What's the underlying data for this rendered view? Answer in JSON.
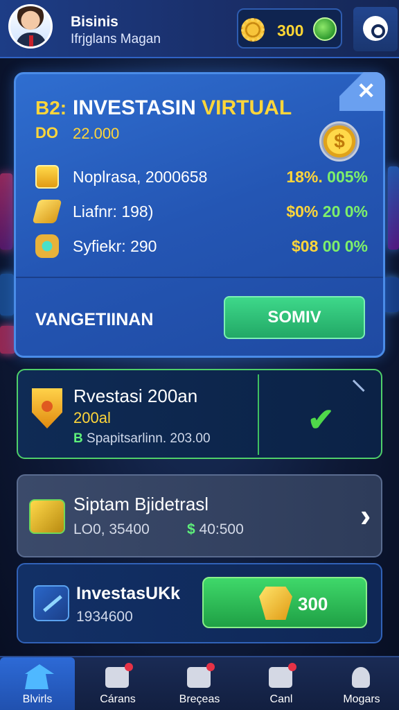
{
  "header": {
    "business_name": "Bisinis",
    "business_subtitle": "Ifrjglans Magan",
    "wallet_amount": "300"
  },
  "panel": {
    "badge": "B2:",
    "title_main": "INVESTASIN",
    "title_highlight": "VIRTUAL",
    "code": "DO",
    "value": "22.000",
    "close_label": "✕",
    "stats": [
      {
        "label": "Noplrasa, 2000658",
        "value": "18%.",
        "value_green": "005%"
      },
      {
        "label": "Liafnr: 198)",
        "value": "$0%",
        "value_green": "20 0%"
      },
      {
        "label": "Syfiekr: 290",
        "value": "$08",
        "value_green": "00 0%"
      }
    ],
    "footer_label": "VANGETIINAN",
    "submit_label": "SOMIV",
    "coin_symbol": "$"
  },
  "investment_card": {
    "title": "Rvestasi  200an",
    "subtitle": "200al",
    "note_prefix": "B",
    "note": "Spapitsarlinn. 203.00",
    "check_symbol": "✔"
  },
  "upgrade_card": {
    "title": "Siptam Bjidetrasl",
    "cost": "LO0, 35400",
    "price_prefix": "$",
    "price": "40:500",
    "chevron": "›"
  },
  "new_investment_card": {
    "title": "InvestasUKk",
    "value": "1934600",
    "buy_label": "300"
  },
  "bottom_nav": {
    "items": [
      {
        "label": "Blvirls",
        "icon": "home-icon"
      },
      {
        "label": "Cárans",
        "icon": "shop-icon"
      },
      {
        "label": "Breçeas",
        "icon": "house-icon"
      },
      {
        "label": "Canl",
        "icon": "camera-icon"
      },
      {
        "label": "Mogars",
        "icon": "profile-icon"
      }
    ]
  },
  "colors": {
    "accent_gold": "#ffd63a",
    "accent_green": "#3ed88a",
    "panel_blue": "#2f6ed0"
  }
}
